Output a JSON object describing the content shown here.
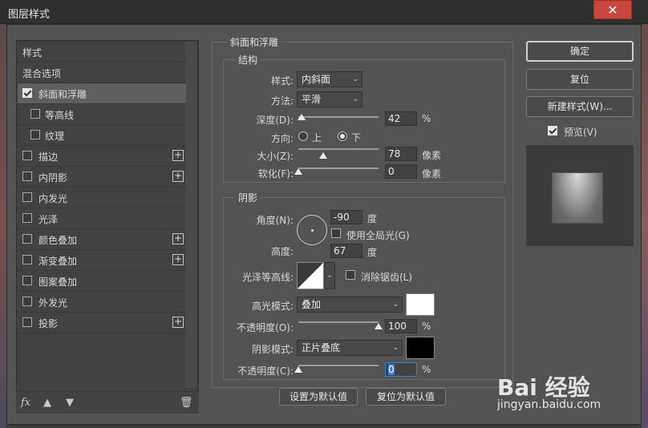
{
  "window": {
    "title": "图层样式",
    "close_icon": "close-icon"
  },
  "left_panel": {
    "items": [
      {
        "label": "样式",
        "checkbox": false,
        "plus": false,
        "selected": false,
        "type": "head"
      },
      {
        "label": "混合选项",
        "checkbox": false,
        "plus": false,
        "selected": false,
        "type": "head"
      },
      {
        "label": "斜面和浮雕",
        "checkbox": true,
        "checked": true,
        "plus": false,
        "selected": true
      },
      {
        "label": "等高线",
        "checkbox": true,
        "checked": false,
        "plus": false,
        "type": "sub"
      },
      {
        "label": "纹理",
        "checkbox": true,
        "checked": false,
        "plus": false,
        "type": "sub"
      },
      {
        "label": "描边",
        "checkbox": true,
        "checked": false,
        "plus": true
      },
      {
        "label": "内阴影",
        "checkbox": true,
        "checked": false,
        "plus": true
      },
      {
        "label": "内发光",
        "checkbox": true,
        "checked": false,
        "plus": false
      },
      {
        "label": "光泽",
        "checkbox": true,
        "checked": false,
        "plus": false
      },
      {
        "label": "颜色叠加",
        "checkbox": true,
        "checked": false,
        "plus": true
      },
      {
        "label": "渐变叠加",
        "checkbox": true,
        "checked": false,
        "plus": true
      },
      {
        "label": "图案叠加",
        "checkbox": true,
        "checked": false,
        "plus": false
      },
      {
        "label": "外发光",
        "checkbox": true,
        "checked": false,
        "plus": false
      },
      {
        "label": "投影",
        "checkbox": true,
        "checked": false,
        "plus": true
      }
    ],
    "toolbar": {
      "fx_label": "fx",
      "up_icon": "arrow-up-icon",
      "down_icon": "arrow-down-icon",
      "trash_icon": "trash-icon"
    }
  },
  "bevel": {
    "section_title": "斜面和浮雕",
    "structure": {
      "title": "结构",
      "style_label": "样式:",
      "style_value": "内斜面",
      "technique_label": "方法:",
      "technique_value": "平滑",
      "depth_label": "深度(D):",
      "depth_value": "42",
      "depth_unit": "%",
      "direction_label": "方向:",
      "dir_up": "上",
      "dir_down": "下",
      "direction_selected": "下",
      "size_label": "大小(Z):",
      "size_value": "78",
      "size_unit": "像素",
      "soften_label": "软化(F):",
      "soften_value": "0",
      "soften_unit": "像素"
    },
    "shading": {
      "title": "阴影",
      "angle_label": "角度(N):",
      "angle_value": "-90",
      "angle_unit": "度",
      "global_light_label": "使用全局光(G)",
      "global_light_checked": false,
      "altitude_label": "高度:",
      "altitude_value": "67",
      "altitude_unit": "度",
      "gloss_label": "光泽等高线:",
      "antialias_label": "消除锯齿(L)",
      "antialias_checked": false,
      "highlight_mode_label": "高光模式:",
      "highlight_mode_value": "叠加",
      "highlight_color": "#ffffff",
      "highlight_opacity_label": "不透明度(O):",
      "highlight_opacity_value": "100",
      "highlight_opacity_unit": "%",
      "shadow_mode_label": "阴影模式:",
      "shadow_mode_value": "正片叠底",
      "shadow_color": "#000000",
      "shadow_opacity_label": "不透明度(C):",
      "shadow_opacity_value": "0",
      "shadow_opacity_unit": "%"
    },
    "make_default": "设置为默认值",
    "reset_default": "复位为默认值"
  },
  "right_panel": {
    "ok": "确定",
    "reset": "复位",
    "new_style": "新建样式(W)...",
    "preview_label": "预览(V)",
    "preview_checked": true
  },
  "sliders": {
    "depth": 0.04,
    "size": 0.31,
    "soften": 0.0,
    "highlight_opacity": 1.0,
    "shadow_opacity": 0.0
  },
  "watermark": {
    "text": "Bai 经验",
    "url": "jingyan.baidu.com"
  }
}
